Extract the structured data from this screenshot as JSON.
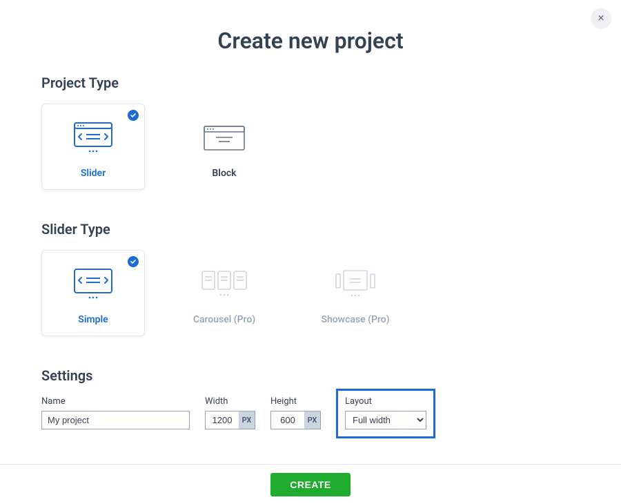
{
  "dialog": {
    "title": "Create new project",
    "close_label": "×"
  },
  "sections": {
    "project_type": {
      "title": "Project Type",
      "options": [
        {
          "label": "Slider",
          "selected": true
        },
        {
          "label": "Block",
          "selected": false
        }
      ]
    },
    "slider_type": {
      "title": "Slider Type",
      "options": [
        {
          "label": "Simple",
          "selected": true,
          "disabled": false
        },
        {
          "label": "Carousel (Pro)",
          "selected": false,
          "disabled": true
        },
        {
          "label": "Showcase (Pro)",
          "selected": false,
          "disabled": true
        }
      ]
    },
    "settings": {
      "title": "Settings",
      "name": {
        "label": "Name",
        "value": "My project"
      },
      "width": {
        "label": "Width",
        "value": "1200",
        "unit": "PX"
      },
      "height": {
        "label": "Height",
        "value": "600",
        "unit": "PX"
      },
      "layout": {
        "label": "Layout",
        "value": "Full width"
      }
    }
  },
  "footer": {
    "create_label": "CREATE"
  },
  "colors": {
    "accent": "#1d6bd6",
    "success": "#1fab2e",
    "muted": "#94a3b8"
  }
}
